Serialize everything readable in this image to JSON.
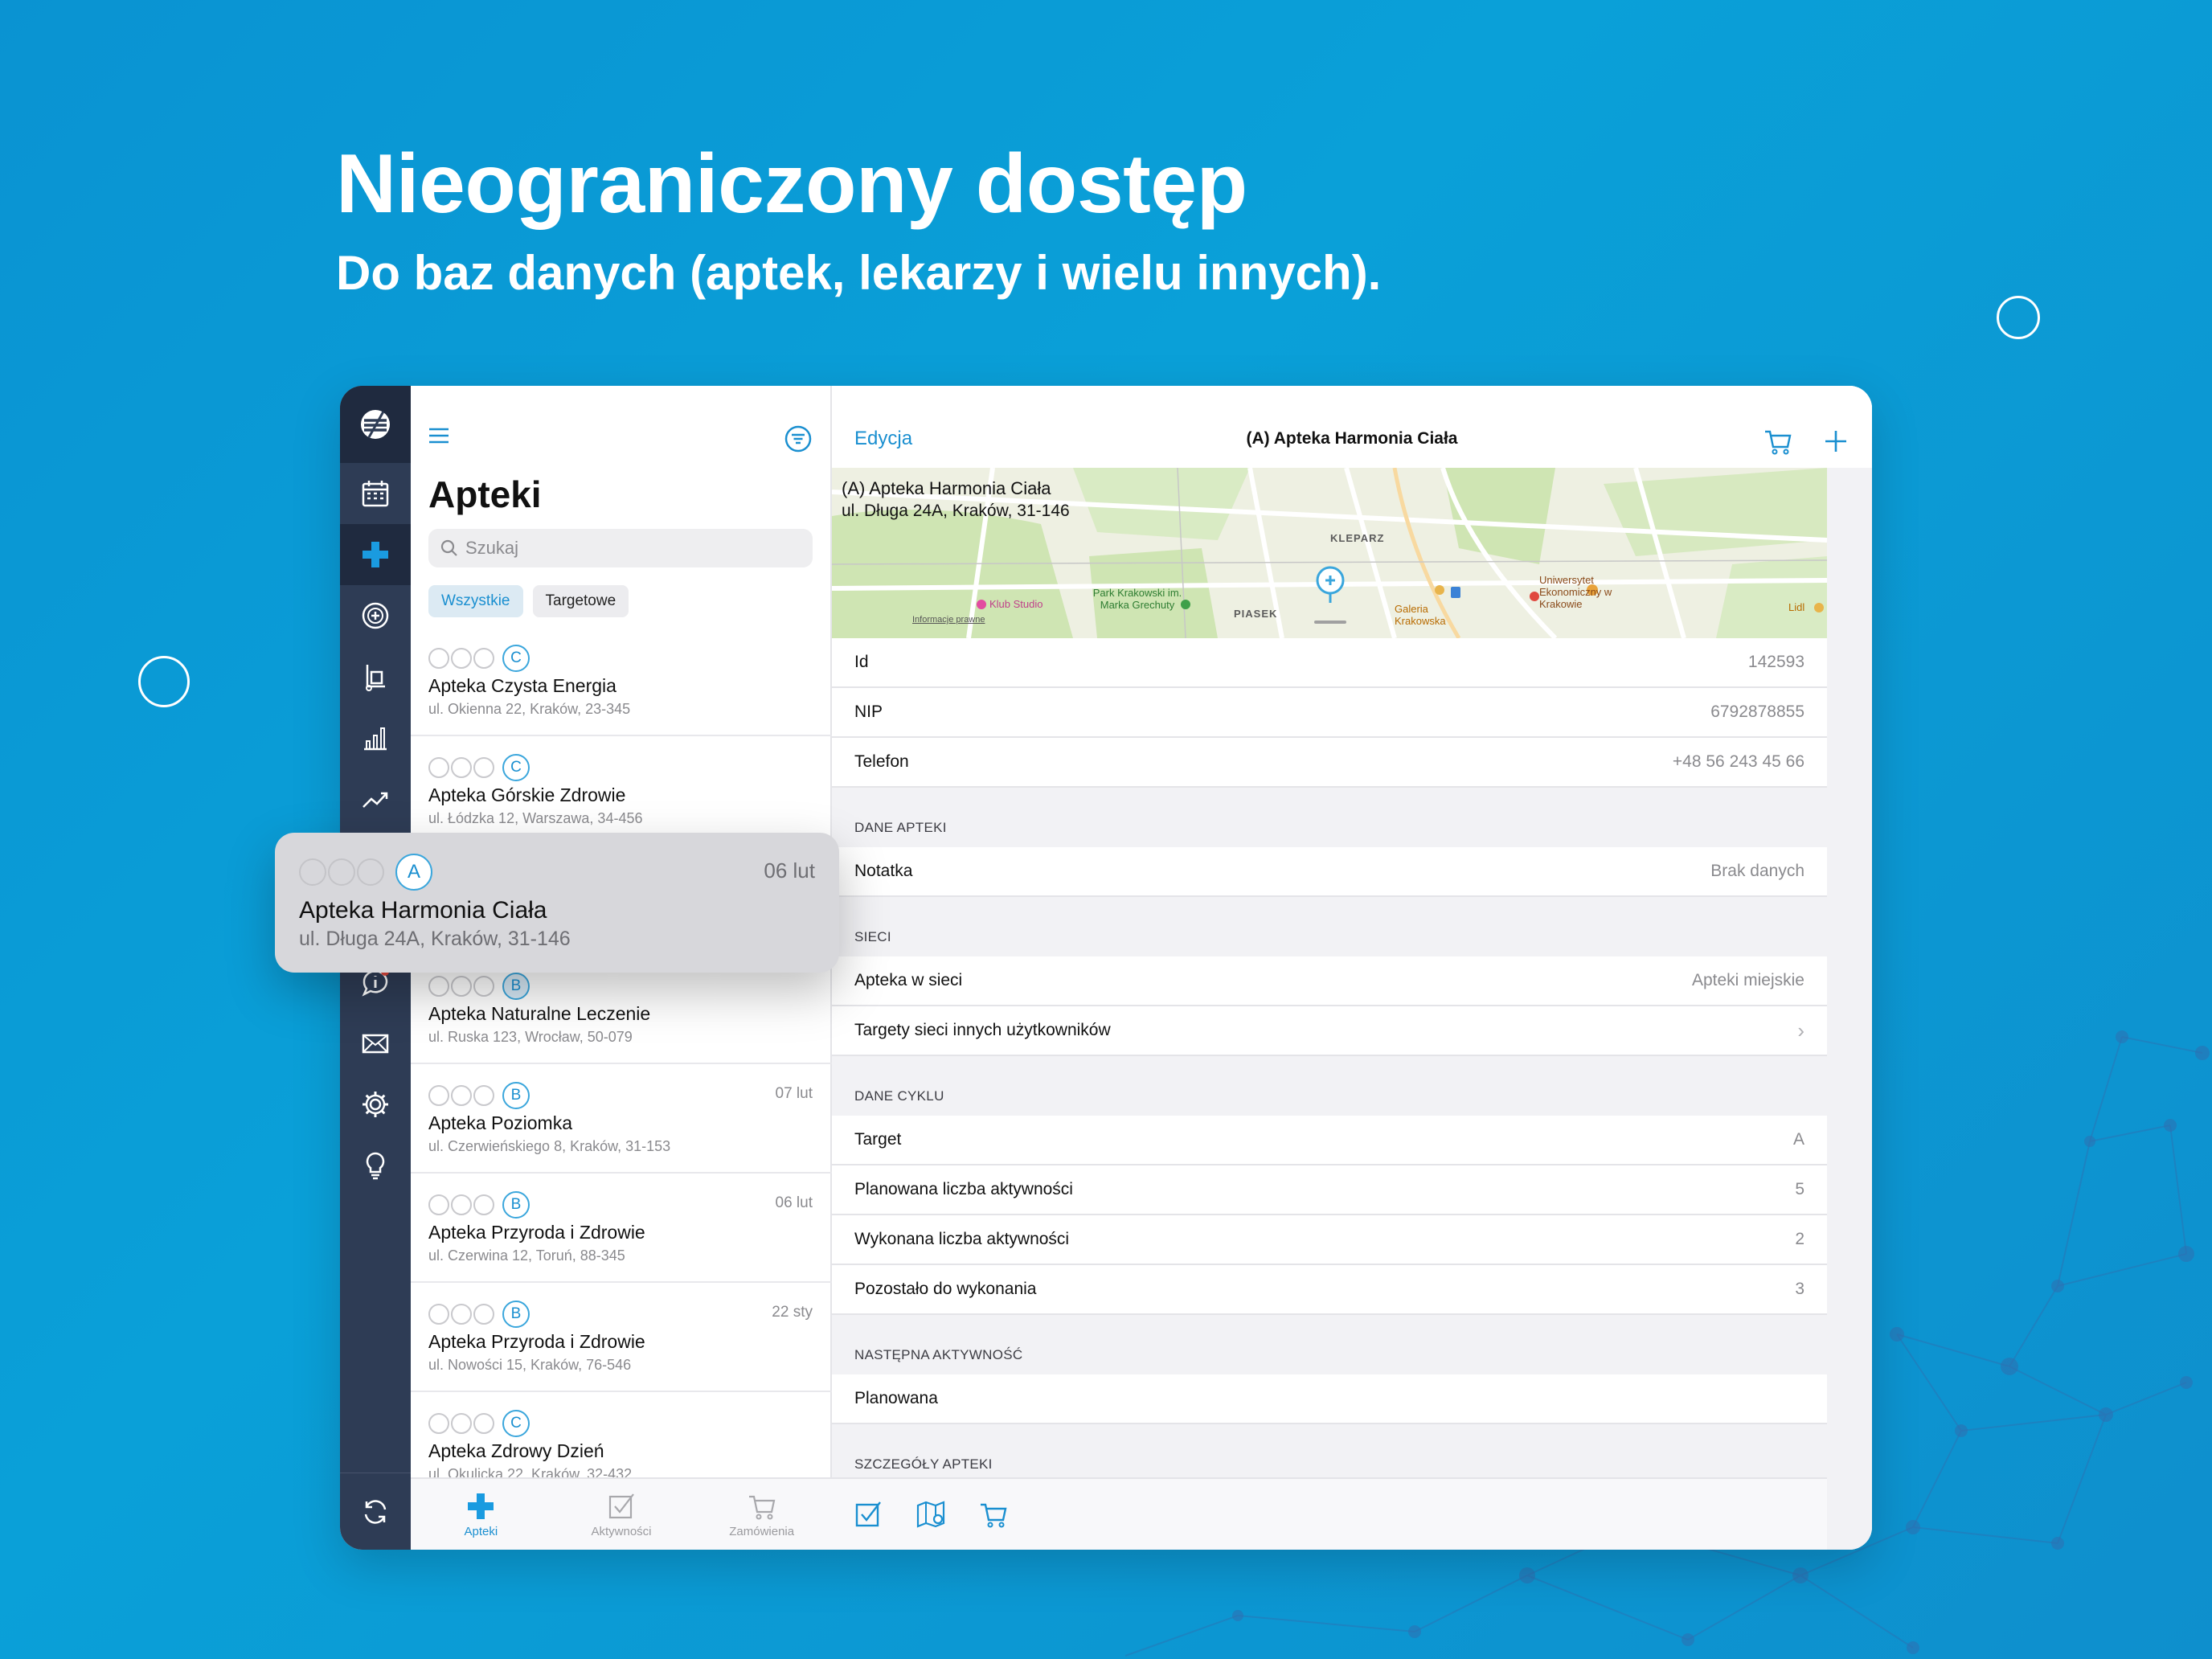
{
  "headline": "Nieograniczony dostęp",
  "subhead": "Do baz danych (aptek, lekarzy i wielu innych).",
  "list": {
    "title": "Apteki",
    "search_placeholder": "Szukaj",
    "chips": [
      "Wszystkie",
      "Targetowe"
    ],
    "rows": [
      {
        "badge": "C",
        "date": "",
        "name": "Apteka Czysta Energia",
        "addr": "ul. Okienna 22, Kraków, 23-345"
      },
      {
        "badge": "C",
        "date": "",
        "name": "Apteka Górskie Zdrowie",
        "addr": "ul. Łódzka 12, Warszawa, 34-456"
      },
      {
        "badge": "A",
        "date": "06 lut",
        "name": "Apteka Harmonia Ciała",
        "addr": "ul. Długa 24A, Kraków, 31-146"
      },
      {
        "badge": "B",
        "date": "",
        "name": "Apteka Naturalne Leczenie",
        "addr": "ul. Ruska 123, Wrocław, 50-079"
      },
      {
        "badge": "B",
        "date": "07 lut",
        "name": "Apteka Poziomka",
        "addr": "ul. Czerwieńskiego 8, Kraków, 31-153"
      },
      {
        "badge": "B",
        "date": "06 lut",
        "name": "Apteka Przyroda i Zdrowie",
        "addr": "ul. Czerwina 12, Toruń, 88-345"
      },
      {
        "badge": "B",
        "date": "22 sty",
        "name": "Apteka Przyroda i Zdrowie",
        "addr": "ul. Nowości 15, Kraków, 76-546"
      },
      {
        "badge": "C",
        "date": "",
        "name": "Apteka Zdrowy Dzień",
        "addr": "ul. Okulicka 22, Kraków, 32-432"
      }
    ],
    "tabs": [
      "Apteki",
      "Aktywności",
      "Zamówienia"
    ]
  },
  "popout": {
    "badge": "A",
    "date": "06 lut",
    "name": "Apteka Harmonia Ciała",
    "addr": "ul. Długa 24A, Kraków, 31-146"
  },
  "detail": {
    "edit": "Edycja",
    "title": "(A) Apteka Harmonia Ciała",
    "map": {
      "line1": "(A) Apteka Harmonia Ciała",
      "line2": "ul. Długa 24A, Kraków, 31-146",
      "places": [
        "KLEPARZ",
        "PIASEK"
      ],
      "poi": [
        "Park Krakowski im. Marka Grechuty",
        "Klub Studio",
        "Uniwersytet Ekonomiczny w Krakowie",
        "Galeria Krakowska",
        "Lidl",
        "Informacje prawne"
      ]
    },
    "rows_top": [
      {
        "label": "Id",
        "value": "142593"
      },
      {
        "label": "NIP",
        "value": "6792878855"
      },
      {
        "label": "Telefon",
        "value": "+48 56 243 45 66"
      }
    ],
    "sec_dane": "DANE APTEKI",
    "notatka": {
      "label": "Notatka",
      "value": "Brak danych"
    },
    "sec_sieci": "SIECI",
    "siec": {
      "label": "Apteka w sieci",
      "value": "Apteki miejskie"
    },
    "targety": "Targety sieci innych użytkowników",
    "sec_cykl": "DANE CYKLU",
    "cykl": [
      {
        "label": "Target",
        "value": "A"
      },
      {
        "label": "Planowana liczba aktywności",
        "value": "5"
      },
      {
        "label": "Wykonana liczba aktywności",
        "value": "2"
      },
      {
        "label": "Pozostało do wykonania",
        "value": "3"
      }
    ],
    "sec_next": "NASTĘPNA AKTYWNOŚĆ",
    "next": "Planowana",
    "sec_szcz": "SZCZEGÓŁY APTEKI"
  },
  "colors": {
    "accent": "#1a8fd0",
    "rail": "#2e3c55",
    "background": "#0a9ad4"
  }
}
